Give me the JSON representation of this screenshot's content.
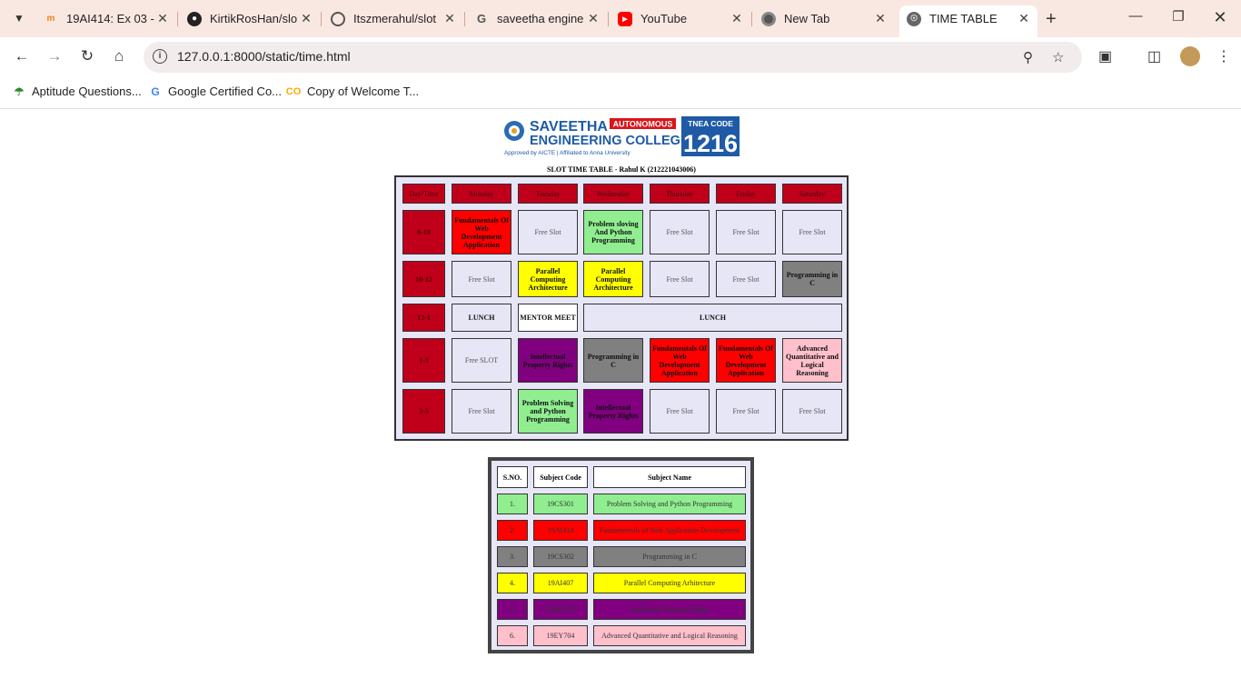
{
  "browser": {
    "tabs": [
      {
        "title": "19AI414: Ex 03 -",
        "icon": "moodle-icon",
        "active": false
      },
      {
        "title": "KirtikRosHan/slo",
        "icon": "github-icon",
        "active": false
      },
      {
        "title": "Itszmerahul/slot",
        "icon": "github-icon",
        "active": false
      },
      {
        "title": "saveetha engine",
        "icon": "google-icon",
        "active": false
      },
      {
        "title": "YouTube",
        "icon": "youtube-icon",
        "active": false
      },
      {
        "title": "New Tab",
        "icon": "chrome-icon",
        "active": false
      },
      {
        "title": "TIME TABLE",
        "icon": "globe-icon",
        "active": true
      }
    ],
    "url": "127.0.0.1:8000/static/time.html",
    "bookmarks": [
      {
        "label": "Aptitude Questions...",
        "icon": "umbrella-icon"
      },
      {
        "label": "Google Certified Co...",
        "icon": "google-icon"
      },
      {
        "label": "Copy of Welcome T...",
        "icon": "colab-icon"
      }
    ]
  },
  "logo": {
    "name_line1": "SAVEETHA",
    "badge": "AUTONOMOUS",
    "name_line2": "ENGINEERING COLLEGE",
    "approval": "Approved by AICTE | Affiliated to Anna University",
    "tnea_label": "TNEA CODE",
    "tnea_code": "1216"
  },
  "timetable": {
    "title": "SLOT TIME TABLE - Rahul K (212221043006)",
    "headers": [
      "Day/Time",
      "Monday",
      "Tuesday",
      "Wednesday",
      "Thursday",
      "Friday",
      "Saturday"
    ],
    "rows": [
      {
        "time": "8-10",
        "cells": [
          {
            "text": "Fundamentals Of Web Development Application",
            "color": "#ff0000"
          },
          {
            "text": "Free Slot",
            "color": "#e6e6f7"
          },
          {
            "text": "Problem sloving And Python Programming",
            "color": "#90ee90"
          },
          {
            "text": "Free Slot",
            "color": "#e6e6f7"
          },
          {
            "text": "Free Slot",
            "color": "#e6e6f7"
          },
          {
            "text": "Free Slot",
            "color": "#e6e6f7"
          }
        ]
      },
      {
        "time": "10-12",
        "cells": [
          {
            "text": "Free Slot",
            "color": "#e6e6f7"
          },
          {
            "text": "Parallel Computing Architecture",
            "color": "#ffff00"
          },
          {
            "text": "Parallel Computing Architecture",
            "color": "#ffff00"
          },
          {
            "text": "Free Slot",
            "color": "#e6e6f7"
          },
          {
            "text": "Free Slot",
            "color": "#e6e6f7"
          },
          {
            "text": "Programming in C",
            "color": "#808080"
          }
        ]
      },
      {
        "time": "12-1",
        "cells": [
          {
            "text": "LUNCH",
            "color": "#e6e6f7"
          },
          {
            "text": "MENTOR MEET",
            "color": "#ffffff"
          },
          {
            "text": "LUNCH",
            "color": "#e6e6f7"
          }
        ]
      },
      {
        "time": "1-3",
        "cells": [
          {
            "text": "Free SLOT",
            "color": "#e6e6f7"
          },
          {
            "text": "Intellectual Property Rights",
            "color": "#800080"
          },
          {
            "text": "Programming in C",
            "color": "#808080"
          },
          {
            "text": "Fundamentals Of Web Development Application",
            "color": "#ff0000"
          },
          {
            "text": "Fundamentals Of Web Development Application",
            "color": "#ff0000"
          },
          {
            "text": "Advanced Quantitative and Logical Reasoning",
            "color": "#ffc0cb"
          }
        ]
      },
      {
        "time": "3-5",
        "cells": [
          {
            "text": "Free Slot",
            "color": "#e6e6f7"
          },
          {
            "text": "Problem Solving and Python Programming",
            "color": "#90ee90"
          },
          {
            "text": "Intellectual Property Rights",
            "color": "#800080"
          },
          {
            "text": "Free Slot",
            "color": "#e6e6f7"
          },
          {
            "text": "Free Slot",
            "color": "#e6e6f7"
          },
          {
            "text": "Free Slot",
            "color": "#e6e6f7"
          }
        ]
      }
    ]
  },
  "subjects": {
    "headers": [
      "S.NO.",
      "Subject Code",
      "Subject Name"
    ],
    "rows": [
      {
        "sno": "1.",
        "code": "19CS301",
        "name": "Problem Solving and Python Programming",
        "color": "#90ee90"
      },
      {
        "sno": "2.",
        "code": "19AI414",
        "name": "Fundamentals of Web Application Development",
        "color": "#ff0000"
      },
      {
        "sno": "3.",
        "code": "19CS302",
        "name": "Programming in C",
        "color": "#808080"
      },
      {
        "sno": "4.",
        "code": "19AI407",
        "name": "Parallel Computing Arhitecture",
        "color": "#ffff00"
      },
      {
        "sno": "5.",
        "code": "20MC501",
        "name": "Intellectual Property Rights",
        "color": "#800080"
      },
      {
        "sno": "6.",
        "code": "19EY704",
        "name": "Advanced Quantitative and Logical Reasoning",
        "color": "#ffc0cb"
      }
    ]
  }
}
